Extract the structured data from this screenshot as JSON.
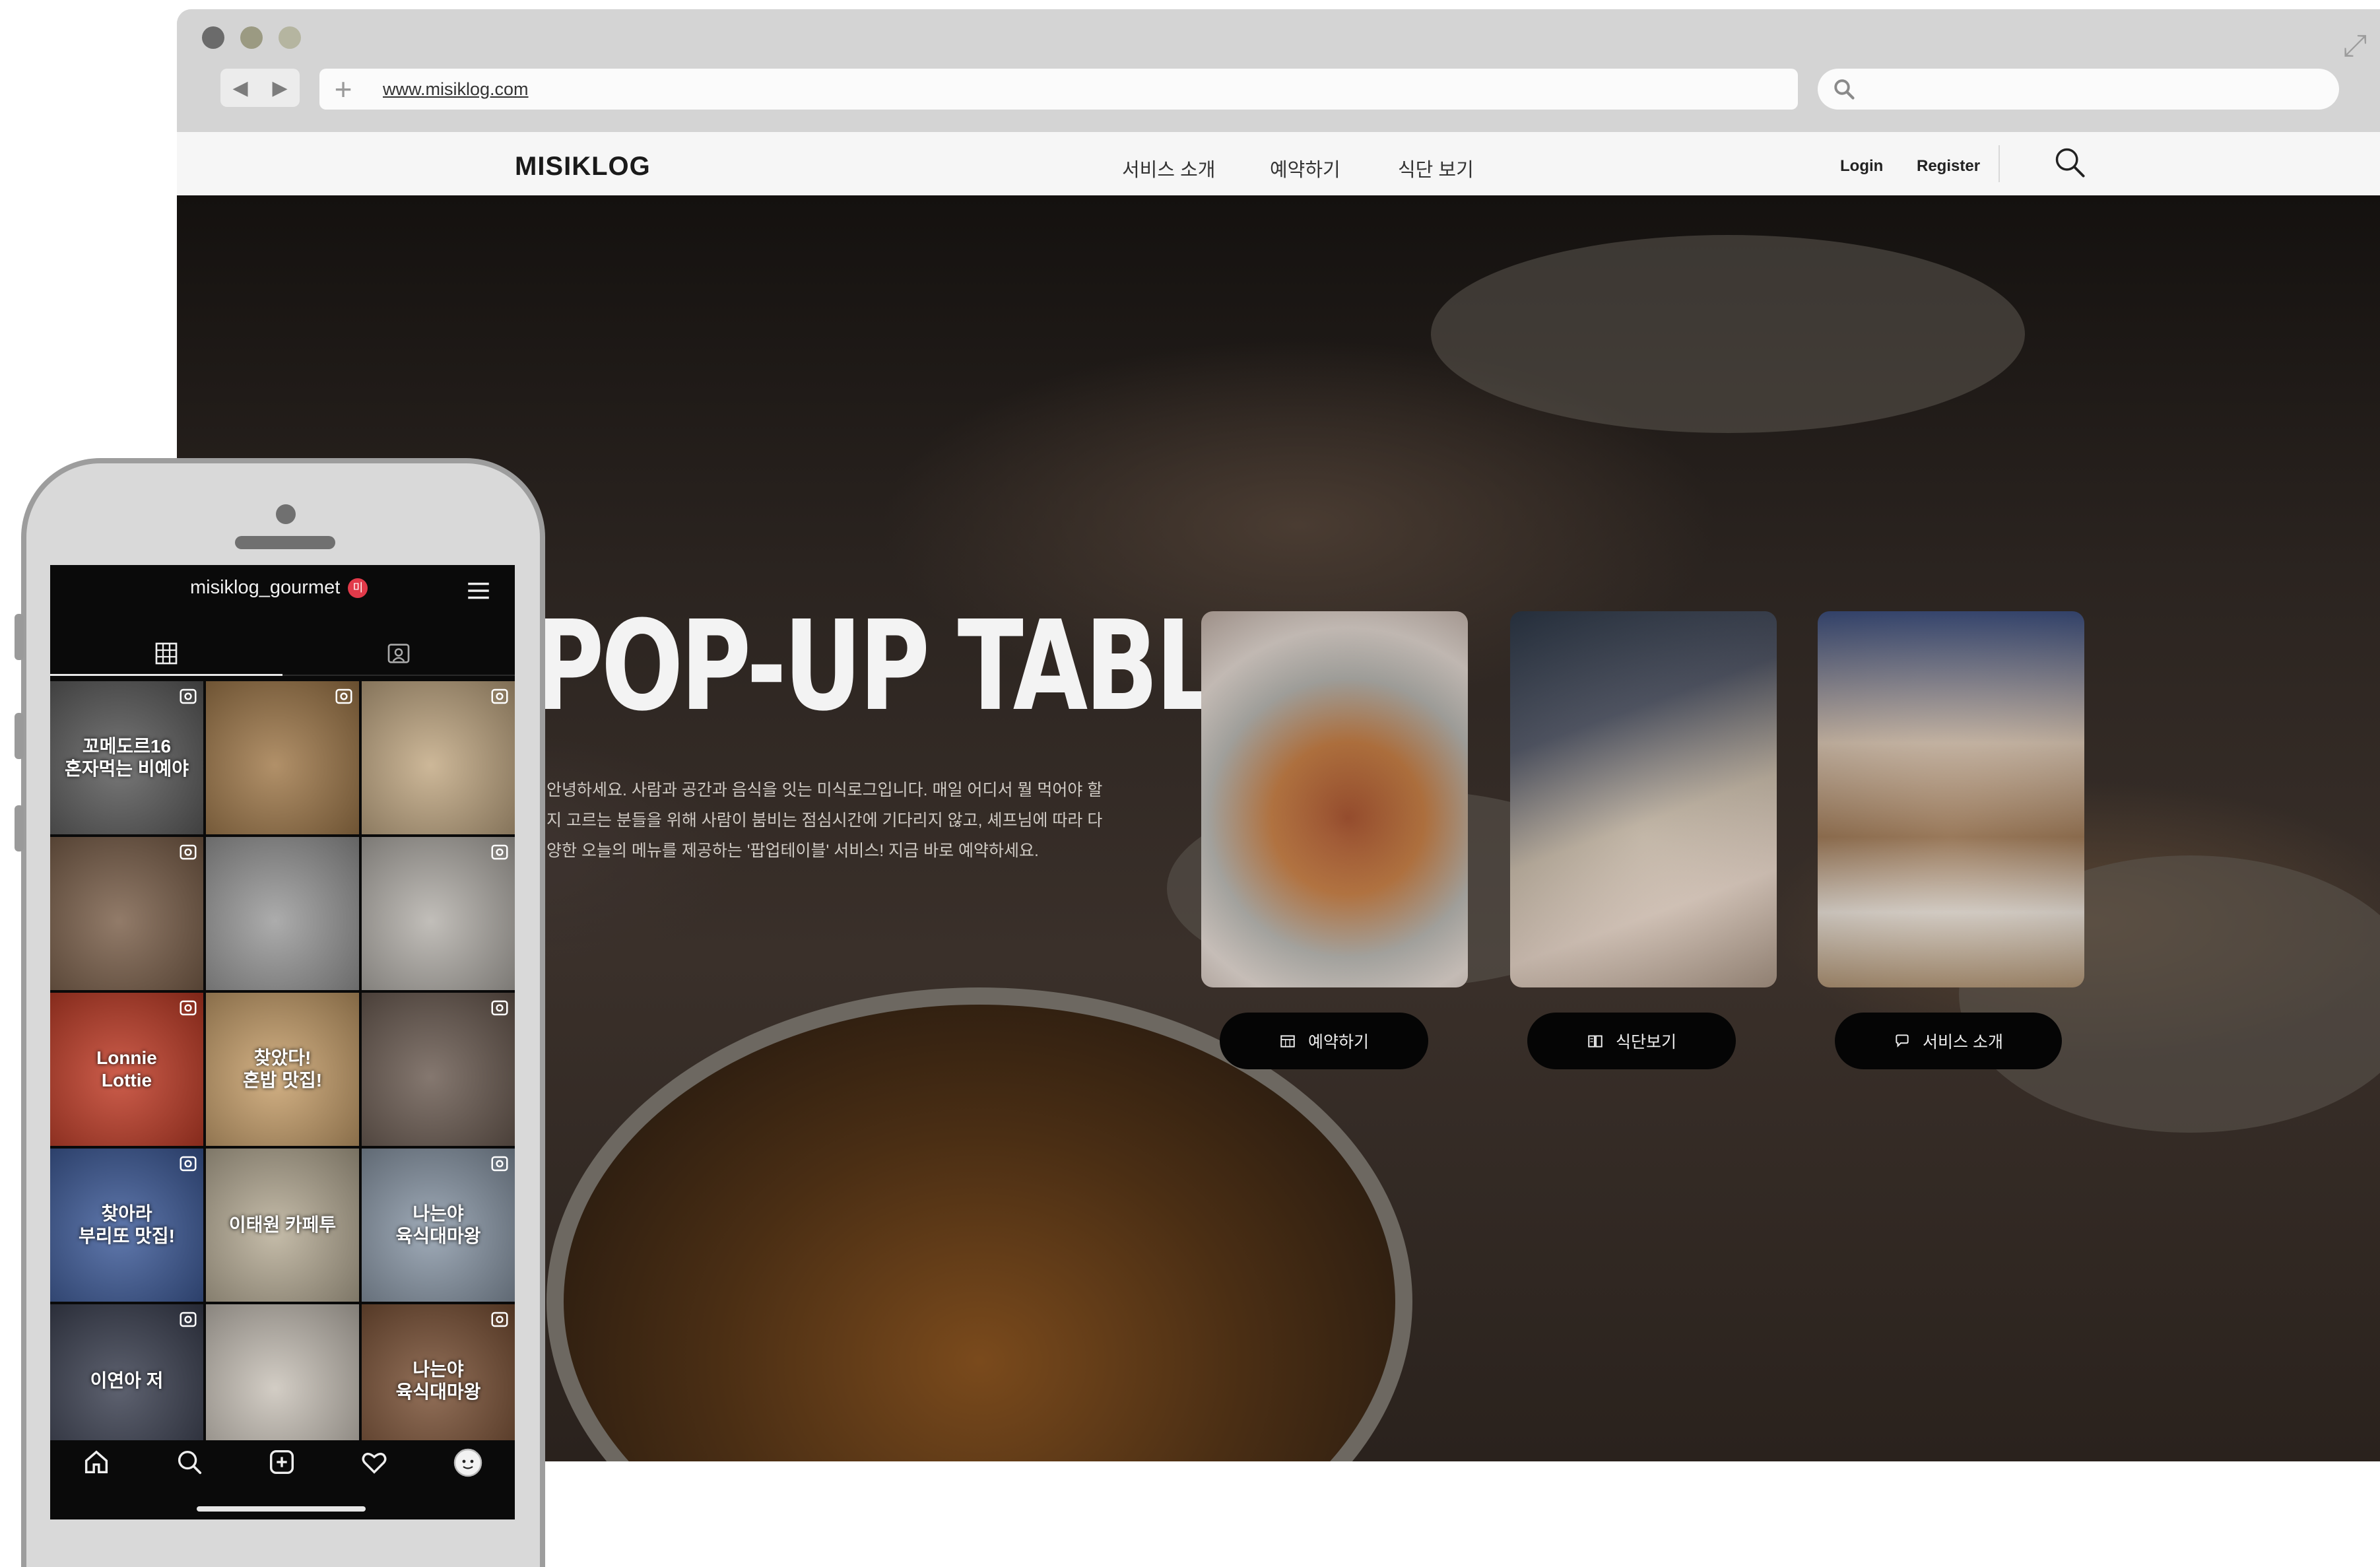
{
  "browser": {
    "url": "www.misiklog.com",
    "nav_prev": "◀",
    "nav_next": "▶",
    "new_tab": "+"
  },
  "site": {
    "logo": "MISIKLOG",
    "menu": [
      "서비스 소개",
      "예약하기",
      "식단 보기"
    ],
    "login": "Login",
    "register": "Register"
  },
  "hero": {
    "title": "POP-UP TABLE",
    "description": [
      "안녕하세요. 사람과 공간과 음식을 잇는 미식로그입니다. 매일 어디서 뭘 먹어야 할",
      "지 고르는 분들을 위해 사람이 붐비는 점심시간에 기다리지 않고, 셰프님에 따라 다",
      "양한 오늘의 메뉴를 제공하는 '팝업테이블' 서비스! 지금 바로 예약하세요."
    ],
    "buttons": [
      {
        "label": "예약하기",
        "icon": "calendar-icon"
      },
      {
        "label": "식단보기",
        "icon": "book-icon"
      },
      {
        "label": "서비스 소개",
        "icon": "chat-bubble-icon"
      }
    ]
  },
  "phone": {
    "username": "misiklog_gourmet",
    "badge": "미",
    "tiles": [
      {
        "text": "꼬메도르16\n혼자먹는 비예야",
        "color": "#5a5a5a",
        "reel": true
      },
      {
        "text": "",
        "color": "#a07848",
        "reel": true
      },
      {
        "text": "",
        "color": "#c2a882",
        "reel": true
      },
      {
        "text": "",
        "color": "#7a5e48",
        "reel": true
      },
      {
        "text": "",
        "color": "#9a9a9a",
        "reel": false
      },
      {
        "text": "",
        "color": "#b4b0aa",
        "reel": true
      },
      {
        "text": "Lonnie\nLottie",
        "color": "#c23a24",
        "reel": true
      },
      {
        "text": "찾았다!\n혼밥 맛집!",
        "color": "#c9a06a",
        "reel": false
      },
      {
        "text": "",
        "color": "#6a5a50",
        "reel": true
      },
      {
        "text": "찾아라\n부리또 맛집!",
        "color": "#3c5a9a",
        "reel": true
      },
      {
        "text": "이태원 카페투",
        "color": "#b8ad96",
        "reel": false
      },
      {
        "text": "나는야\n육식대마왕",
        "color": "#8a98a8",
        "reel": true
      },
      {
        "text": "이연아 저",
        "color": "#3a3f50",
        "reel": true
      },
      {
        "text": "",
        "color": "#c9c2b8",
        "reel": false
      },
      {
        "text": "나는야\n육식대마왕",
        "color": "#7a5034",
        "reel": true
      }
    ]
  },
  "colors": {
    "accent_badge": "#e23a4a",
    "button_bg": "#050505"
  }
}
